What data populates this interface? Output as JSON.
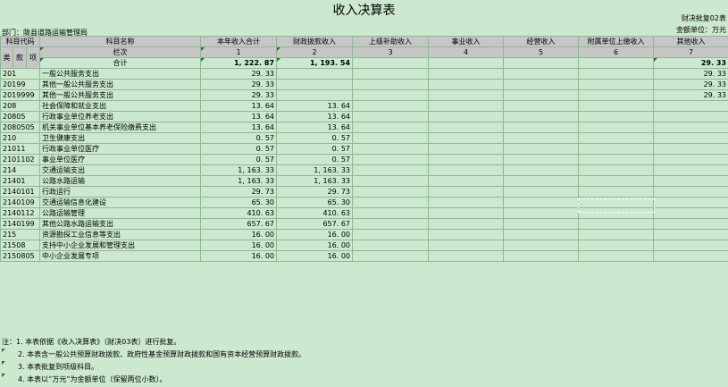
{
  "title": "收入决算表",
  "form_code": "财决批复02表",
  "unit": "金额单位：万元",
  "department": "部门：陇县道路运输管理局",
  "headers": {
    "code": "科目代码",
    "name": "科目名称",
    "cols": [
      "本年收入合计",
      "财政拨款收入",
      "上级补助收入",
      "事业收入",
      "经营收入",
      "附属单位上缴收入",
      "其他收入"
    ],
    "lei": "类",
    "kuan": "款",
    "xiang": "项",
    "lanci": "栏次",
    "lanci_nums": [
      "1",
      "2",
      "3",
      "4",
      "5",
      "6",
      "7"
    ]
  },
  "total": {
    "label": "合计",
    "values": [
      "1, 222. 87",
      "1, 193. 54",
      "",
      "",
      "",
      "",
      "29. 33"
    ]
  },
  "rows": [
    {
      "code": "201",
      "name": "一般公共服务支出",
      "indent": false,
      "values": [
        "29. 33",
        "",
        "",
        "",
        "",
        "",
        "29. 33"
      ]
    },
    {
      "code": "20199",
      "name": "其他一般公共服务支出",
      "indent": false,
      "values": [
        "29. 33",
        "",
        "",
        "",
        "",
        "",
        "29. 33"
      ]
    },
    {
      "code": "2019999",
      "name": "其他一般公共服务支出",
      "indent": true,
      "values": [
        "29. 33",
        "",
        "",
        "",
        "",
        "",
        "29. 33"
      ]
    },
    {
      "code": "208",
      "name": "社会保障和就业支出",
      "indent": false,
      "values": [
        "13. 64",
        "13. 64",
        "",
        "",
        "",
        "",
        ""
      ]
    },
    {
      "code": "20805",
      "name": "行政事业单位养老支出",
      "indent": false,
      "values": [
        "13. 64",
        "13. 64",
        "",
        "",
        "",
        "",
        ""
      ]
    },
    {
      "code": "2080505",
      "name": "机关事业单位基本养老保险缴费支出",
      "indent": true,
      "values": [
        "13. 64",
        "13. 64",
        "",
        "",
        "",
        "",
        ""
      ]
    },
    {
      "code": "210",
      "name": "卫生健康支出",
      "indent": false,
      "values": [
        "0. 57",
        "0. 57",
        "",
        "",
        "",
        "",
        ""
      ]
    },
    {
      "code": "21011",
      "name": "行政事业单位医疗",
      "indent": false,
      "values": [
        "0. 57",
        "0. 57",
        "",
        "",
        "",
        "",
        ""
      ]
    },
    {
      "code": "2101102",
      "name": "事业单位医疗",
      "indent": true,
      "values": [
        "0. 57",
        "0. 57",
        "",
        "",
        "",
        "",
        ""
      ]
    },
    {
      "code": "214",
      "name": "交通运输支出",
      "indent": false,
      "values": [
        "1, 163. 33",
        "1, 163. 33",
        "",
        "",
        "",
        "",
        ""
      ]
    },
    {
      "code": "21401",
      "name": "公路水路运输",
      "indent": false,
      "values": [
        "1, 163. 33",
        "1, 163. 33",
        "",
        "",
        "",
        "",
        ""
      ]
    },
    {
      "code": "2140101",
      "name": "行政运行",
      "indent": true,
      "values": [
        "29. 73",
        "29. 73",
        "",
        "",
        "",
        "",
        ""
      ]
    },
    {
      "code": "2140109",
      "name": "交通运输信息化建设",
      "indent": true,
      "values": [
        "65. 30",
        "65. 30",
        "",
        "",
        "",
        "",
        ""
      ]
    },
    {
      "code": "2140112",
      "name": "公路运输管理",
      "indent": true,
      "values": [
        "410. 63",
        "410. 63",
        "",
        "",
        "",
        "",
        ""
      ]
    },
    {
      "code": "2140199",
      "name": "其他公路水路运输支出",
      "indent": true,
      "values": [
        "657. 67",
        "657. 67",
        "",
        "",
        "",
        "",
        ""
      ]
    },
    {
      "code": "215",
      "name": "资源勘探工业信息等支出",
      "indent": false,
      "values": [
        "16. 00",
        "16. 00",
        "",
        "",
        "",
        "",
        ""
      ]
    },
    {
      "code": "21508",
      "name": "支持中小企业发展和管理支出",
      "indent": false,
      "values": [
        "16. 00",
        "16. 00",
        "",
        "",
        "",
        "",
        ""
      ]
    },
    {
      "code": "2150805",
      "name": "中小企业发展专项",
      "indent": true,
      "values": [
        "16. 00",
        "16. 00",
        "",
        "",
        "",
        "",
        ""
      ]
    }
  ],
  "notes": [
    "注：1. 本表依据《收入决算表》（财决03表）进行批复。",
    "2. 本表含一般公共预算财政拨款、政府性基金预算财政拨款和国有资本经营预算财政拨款。",
    "3. 本表批复到项级科目。",
    "4. 本表以“万元”为金额单位（保留两位小数）。"
  ]
}
